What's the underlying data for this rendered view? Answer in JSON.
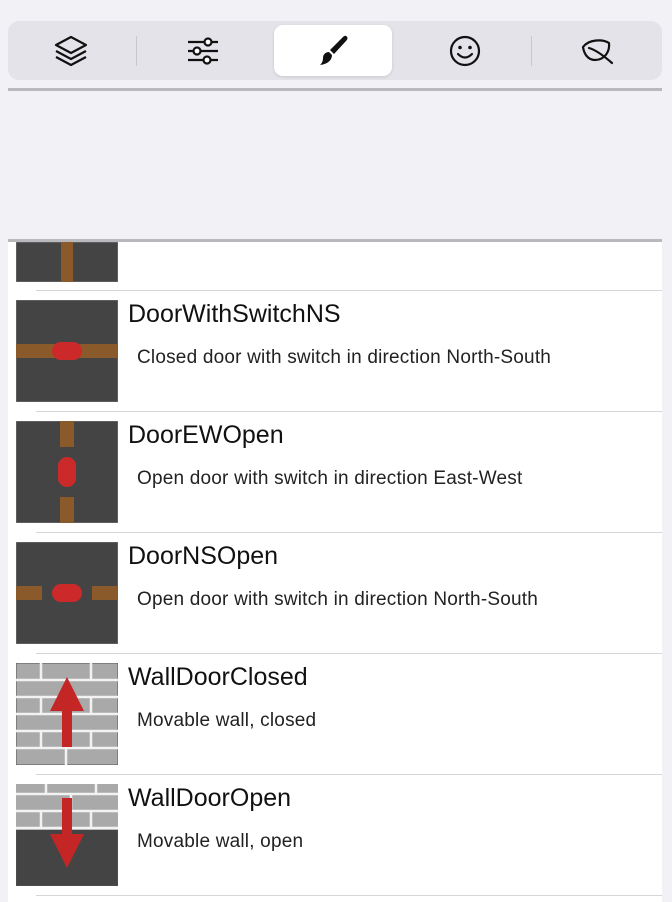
{
  "tabbar": {
    "tabs": [
      {
        "icon": "layers-icon",
        "selected": false
      },
      {
        "icon": "sliders-icon",
        "selected": false
      },
      {
        "icon": "paintbrush-icon",
        "selected": true
      },
      {
        "icon": "smiley-icon",
        "selected": false
      },
      {
        "icon": "leaf-icon",
        "selected": false
      }
    ]
  },
  "items": [
    {
      "title": "DoorWithSwitchNS",
      "description": "Closed door with switch in direction North-South",
      "thumb": "door-closed-ns"
    },
    {
      "title": "DoorEWOpen",
      "description": "Open door with switch in direction East-West",
      "thumb": "door-open-ew"
    },
    {
      "title": "DoorNSOpen",
      "description": "Open door with switch in direction North-South",
      "thumb": "door-open-ns"
    },
    {
      "title": "WallDoorClosed",
      "description": "Movable wall, closed",
      "thumb": "wall-up-arrow"
    },
    {
      "title": "WallDoorOpen",
      "description": "Movable wall, open",
      "thumb": "wall-down-arrow"
    }
  ],
  "colors": {
    "tile": "#444444",
    "door": "#8a5a2b",
    "switch": "#cc2a2a",
    "wall": "#a9a9a9",
    "arrow": "#c42525"
  }
}
